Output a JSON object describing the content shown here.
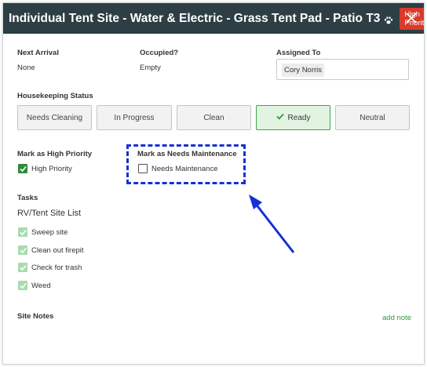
{
  "modal": {
    "title": "Individual Tent Site - Water & Electric - Grass Tent Pad - Patio T3",
    "priority_badge": "High Priority",
    "colors": {
      "header_bg": "#2d3e44",
      "badge_bg": "#d83a2b",
      "accent_green": "#2e9a3c",
      "annotation_blue": "#1530d6"
    }
  },
  "info": {
    "next_arrival_label": "Next Arrival",
    "next_arrival_value": "None",
    "occupied_label": "Occupied?",
    "occupied_value": "Empty",
    "assigned_label": "Assigned To",
    "assigned_value": "Cory Norris"
  },
  "housekeeping": {
    "label": "Housekeeping Status",
    "options": [
      "Needs Cleaning",
      "In Progress",
      "Clean",
      "Ready",
      "Neutral"
    ],
    "selected": "Ready"
  },
  "priority": {
    "label": "Mark as High Priority",
    "checkbox_label": "High Priority",
    "checked": true
  },
  "maintenance": {
    "label": "Mark as Needs Maintenance",
    "checkbox_label": "Needs Maintenance",
    "checked": false
  },
  "tasks": {
    "label": "Tasks",
    "list_title": "RV/Tent Site List",
    "items": [
      "Sweep site",
      "Clean out firepit",
      "Check for trash",
      "Weed"
    ]
  },
  "notes": {
    "label": "Site Notes",
    "add_link": "add note"
  },
  "icons": {
    "title_icon": "paw-icon",
    "close": "close-icon",
    "checkbox_check": "checkmark-icon"
  }
}
